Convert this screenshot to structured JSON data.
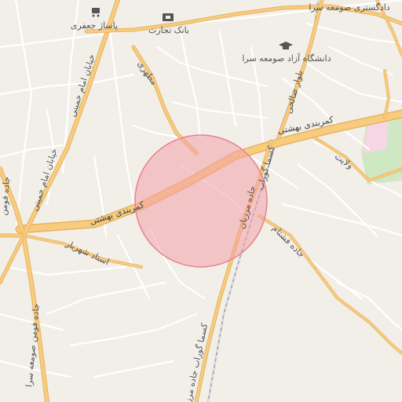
{
  "map": {
    "labels": {
      "jafari_passage": "پاساژ جعفری",
      "tejarat_bank": "بانک تجارت",
      "azad_university": "دانشگاه آزاد صومعه سرا",
      "courthouse": "دادگستری صومعه سرا",
      "imam_khomeini_1": "خیابان امام خمینی",
      "imam_khomeini_2": "خیابان امام خمینی",
      "beheshti_1": "کمربندی بهشتی",
      "beheshti_2": "کمربندی بهشتی",
      "motahari": "مطهری",
      "salehi_blvd": "بلوار صالحی",
      "vilayat": "ولایت",
      "fooman_road": "جاده فومن صومعه سرا",
      "fooman_road_top": "جاده فومن",
      "ostad_shahriar": "استاد شهریار",
      "kasma_road": "کسما گوراب",
      "shaftah_road": "جاده فشتام",
      "marzian_road": "جاده مرزیان",
      "kar_road_south": "کسما گوراب جاده مرزیان"
    },
    "highlight": {
      "color": "#f4a0a8",
      "stroke": "#e6838e"
    },
    "colors": {
      "background": "#f2efe9",
      "major_road": "#f7cc7e",
      "major_road_edge": "#e8b363",
      "minor_road": "#ffffff",
      "railway": "#a0a0a8",
      "park": "#cfe8c4",
      "pink_area": "#f7d6e4"
    },
    "icons": {
      "shop": "cart-icon",
      "bank": "bank-icon",
      "university": "graduation-cap-icon"
    }
  }
}
